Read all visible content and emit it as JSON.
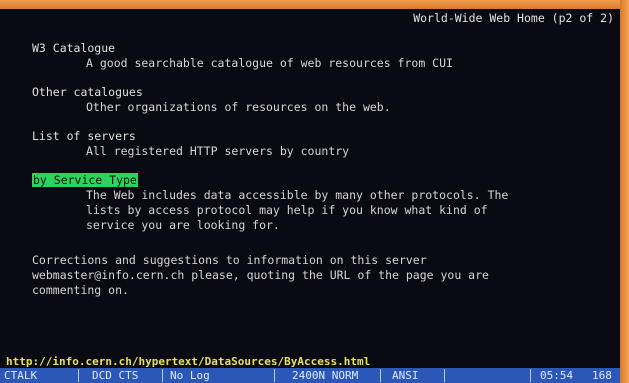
{
  "header": {
    "title": "World-Wide Web Home (p2 of 2)"
  },
  "entries": [
    {
      "title": "W3 Catalogue",
      "description": "A good searchable catalogue of web resources from CUI"
    },
    {
      "title": "Other catalogues",
      "description": "Other organizations of resources on the web."
    },
    {
      "title": "List of servers",
      "description": "All registered HTTP servers by country"
    },
    {
      "title": "by Service Type",
      "description": "The Web includes data accessible by many other protocols. The\nlists by access protocol may help if you know what kind of\nservice you are looking for."
    }
  ],
  "footer": {
    "text": "Corrections and suggestions to information on this server\nwebmaster@info.cern.ch please, quoting the URL of the page you are\ncommenting on."
  },
  "url_bar": {
    "url": "http://info.cern.ch/hypertext/DataSources/ByAccess.html"
  },
  "status_bar": {
    "mode": "CTALK",
    "signals": "DCD CTS",
    "log": "No Log",
    "baud": "2400N NORM",
    "emulation": "ANSI",
    "time": "05:54",
    "count": "168"
  },
  "colors": {
    "highlight": "#2bd45a",
    "status_bar": "#2b58b8",
    "url_text": "#e8e060",
    "screen_bg": "#0a0a12",
    "bezel": "#e98a3a"
  }
}
